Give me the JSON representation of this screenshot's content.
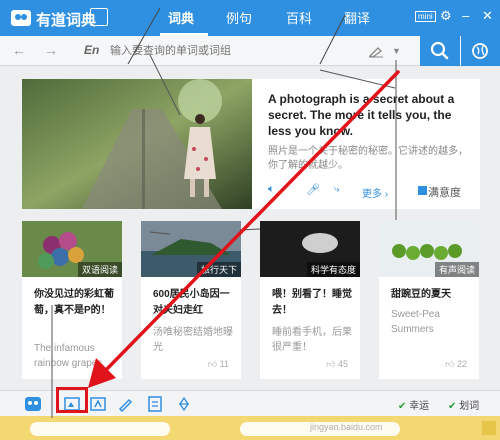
{
  "app": {
    "title": "有道词典"
  },
  "tabs": [
    {
      "label": "词典",
      "active": true
    },
    {
      "label": "例句",
      "active": false
    },
    {
      "label": "百科",
      "active": false
    },
    {
      "label": "翻译",
      "active": false
    }
  ],
  "window": {
    "mini_label": "mini",
    "gear_glyph": "⚙",
    "min_glyph": "–",
    "close_glyph": "✕"
  },
  "search": {
    "lang": "En",
    "placeholder": "输入要查询的单词或词组",
    "back_glyph": "←",
    "forward_glyph": "→"
  },
  "hero": {
    "quote": "A photograph is a secret about a secret. The more it tells you, the less you know.",
    "translation": "照片是一个关于秘密的秘密。它讲述的越多，你了解的就越少。",
    "more_label": "更多 ›",
    "satisfaction_label": "满意度"
  },
  "cards": [
    {
      "tag": "双语阅读",
      "title": "你没见过的彩虹葡萄，真不是P的！",
      "subtitle": "The infamous rainbow grapes",
      "likes": ""
    },
    {
      "tag": "旅行天下",
      "title": "600居民小岛因一对夫妇走红",
      "subtitle": "汤唯秘密结婚地曝光",
      "likes": "11"
    },
    {
      "tag": "科学有态度",
      "title": "喂！别看了！睡觉去！",
      "subtitle": "睡前看手机，后果很严重！",
      "likes": "45"
    },
    {
      "tag": "有声阅读",
      "title": "甜豌豆的夏天",
      "subtitle": "Sweet-Pea Summers",
      "likes": "22"
    }
  ],
  "bottombar": {
    "right_labels": [
      "幸运",
      "划词"
    ]
  },
  "ad": {
    "watermark": "jingyan.baidu.com"
  },
  "colors": {
    "brand": "#2f8fe0",
    "highlight": "#e1131a",
    "ad": "#f3d770"
  }
}
